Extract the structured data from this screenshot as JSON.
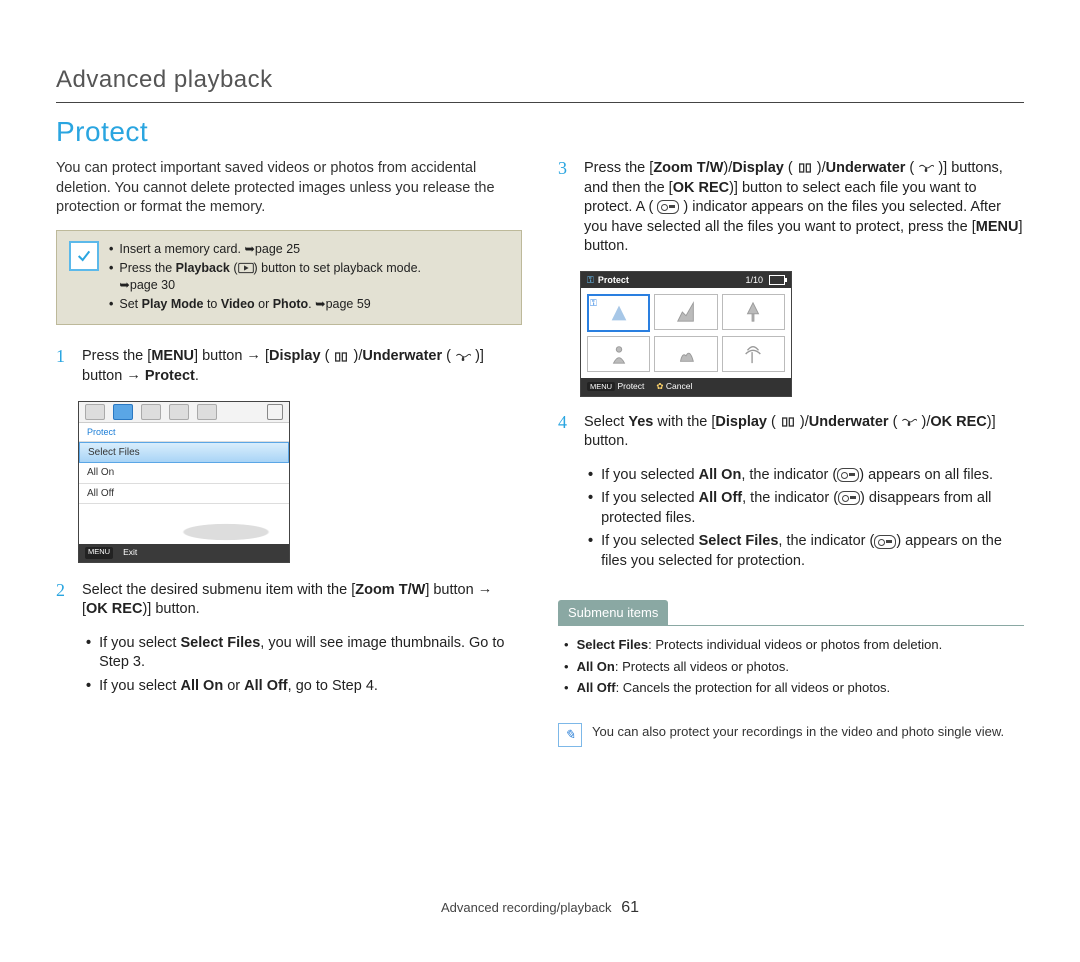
{
  "breadcrumb": "Advanced playback",
  "section_title": "Protect",
  "intro": "You can protect important saved videos or photos from accidental deletion. You cannot delete protected images unless you release the protection or format the memory.",
  "prereqs": [
    {
      "pre": "Insert a memory card. ",
      "ref": "page 25"
    },
    {
      "pre": "Press the ",
      "bold": "Playback",
      "mid": " (",
      "icon": "playback-icon",
      "post": ") button to set playback mode. ",
      "ref": "page 30"
    },
    {
      "pre": "Set ",
      "b1": "Play Mode",
      "mid1": " to ",
      "b2": "Video",
      "mid2": " or ",
      "b3": "Photo",
      "post": ". ",
      "ref": "page 59"
    }
  ],
  "steps": {
    "s1": {
      "a": "Press the [",
      "b1": "MENU",
      "a2": "] button ",
      "arrow1": "→",
      "a3": " [",
      "b2": "Display",
      "a4": " (",
      "icon1": "display-icon",
      "a5": ")/",
      "b3": "Underwater",
      "a6": " (",
      "icon2": "underwater-icon",
      "a7": ")] button ",
      "arrow2": "→",
      "a8": " ",
      "b4": "Protect",
      "a9": "."
    },
    "s2": {
      "a": "Select the desired submenu item with the [",
      "b1": "Zoom T/W",
      "a2": "] button ",
      "arrow": "→",
      "a3": " [",
      "b2": "OK REC",
      "a4": ")] button.",
      "bullets": [
        {
          "t1": "If you select ",
          "b": "Select Files",
          "t2": ", you will see image thumbnails. Go to Step 3."
        },
        {
          "t1": "If you select ",
          "b": "All On",
          "mid": " or ",
          "b2": "All Off",
          "t2": ", go to Step 4."
        }
      ]
    },
    "s3": {
      "a": "Press the [",
      "b1": "Zoom T/W",
      "a2": ")/",
      "b2": "Display",
      "a3": " (",
      "icon1": "display-icon",
      "a4": ")/",
      "b3": "Underwater",
      "a5": " (",
      "icon2": "underwater-icon",
      "a6": ")] buttons, and then the [",
      "b4": "OK REC",
      "a7": ")] button to select each file you want to protect. A (",
      "icon3": "key-icon",
      "a8": ") indicator appears on the files you selected. After you have selected all the files you want to protect, press the [",
      "b5": "MENU",
      "a9": "] button."
    },
    "s4": {
      "a": "Select ",
      "b1": "Yes",
      "a2": " with the [",
      "b2": "Display",
      "a3": " (",
      "icon1": "display-icon",
      "a4": ")/",
      "b3": "Underwater",
      "a5": " (",
      "icon2": "underwater-icon",
      "a6": ")/",
      "b4": "OK REC",
      "a7": ")] button.",
      "bullets": [
        {
          "t1": "If you selected ",
          "b": "All On",
          "t2": ", the indicator (",
          "icon": "key-icon",
          "t3": ") appears on all files."
        },
        {
          "t1": "If you selected ",
          "b": "All Off",
          "t2": ", the indicator (",
          "icon": "key-icon",
          "t3": ") disappears from all protected files."
        },
        {
          "t1": "If you selected ",
          "b": "Select Files",
          "t2": ", the indicator (",
          "icon": "key-icon",
          "t3": ") appears on the files you selected for protection."
        }
      ]
    }
  },
  "lcd1": {
    "header": "Protect",
    "items": [
      "Select Files",
      "All On",
      "All Off"
    ],
    "footer_label": "Exit",
    "footer_chip": "MENU"
  },
  "lcd2": {
    "title": "Protect",
    "counter": "1/10",
    "footer_protect": "Protect",
    "footer_protect_chip": "MENU",
    "footer_cancel": "Cancel"
  },
  "submenu": {
    "tab": "Submenu items",
    "items": [
      {
        "b": "Select Files",
        "t": ": Protects individual videos or photos from deletion."
      },
      {
        "b": "All On",
        "t": ": Protects all videos or photos."
      },
      {
        "b": "All Off",
        "t": ": Cancels the protection for all videos or photos."
      }
    ]
  },
  "tip": "You can also protect your recordings in the video and photo single view.",
  "footer": {
    "section": "Advanced recording/playback",
    "page": "61"
  }
}
